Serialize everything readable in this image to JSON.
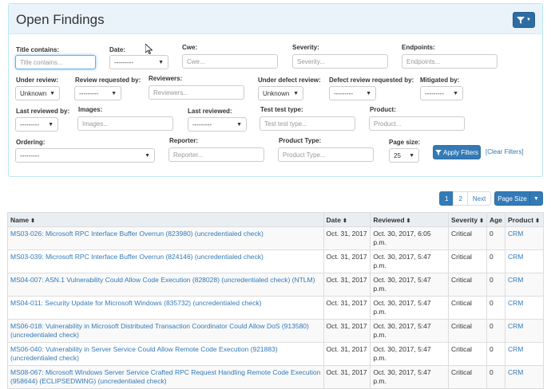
{
  "panel": {
    "title": "Open Findings"
  },
  "filters": {
    "title_contains": {
      "label": "Title contains:",
      "placeholder": "Title contains..."
    },
    "date": {
      "label": "Date:",
      "value": "---------"
    },
    "cwe": {
      "label": "Cwe:",
      "placeholder": "Cwe..."
    },
    "severity": {
      "label": "Severity:",
      "placeholder": "Severity..."
    },
    "endpoints": {
      "label": "Endpoints:",
      "placeholder": "Endpoints..."
    },
    "under_review": {
      "label": "Under review:",
      "value": "Unknown"
    },
    "review_requested_by": {
      "label": "Review requested by:",
      "value": "---------"
    },
    "reviewers": {
      "label": "Reviewers:",
      "placeholder": "Reviewers..."
    },
    "under_defect_review": {
      "label": "Under defect review:",
      "value": "Unknown"
    },
    "defect_review_requested_by": {
      "label": "Defect review requested by:",
      "value": "---------"
    },
    "mitigated_by": {
      "label": "Mitigated by:",
      "value": "---------"
    },
    "last_reviewed_by": {
      "label": "Last reviewed by:",
      "value": "---------"
    },
    "images": {
      "label": "Images:",
      "placeholder": "Images..."
    },
    "last_reviewed": {
      "label": "Last reviewed:",
      "value": "---------"
    },
    "test_test_type": {
      "label": "Test test type:",
      "placeholder": "Test test type..."
    },
    "product": {
      "label": "Product:",
      "placeholder": "Product..."
    },
    "ordering": {
      "label": "Ordering:",
      "value": "---------"
    },
    "reporter": {
      "label": "Reporter:",
      "placeholder": "Reporter..."
    },
    "product_type": {
      "label": "Product Type:",
      "placeholder": "Product Type..."
    },
    "page_size": {
      "label": "Page size:",
      "value": "25"
    },
    "apply_label": "Apply Filters",
    "clear_label": "[Clear Filters]"
  },
  "pagination": {
    "pages": [
      "1",
      "2"
    ],
    "next": "Next",
    "page_size_label": "Page Size"
  },
  "table": {
    "headers": [
      "Name",
      "Date",
      "Reviewed",
      "Severity",
      "Age",
      "Product"
    ],
    "rows": [
      {
        "name": "MS03-026: Microsoft RPC Interface Buffer Overrun (823980) (uncredentialed check)",
        "date": "Oct. 31, 2017",
        "reviewed": "Oct. 30, 2017, 6:05 p.m.",
        "severity": "Critical",
        "age": "0",
        "product": "CRM"
      },
      {
        "name": "MS03-039: Microsoft RPC Interface Buffer Overrun (824146) (uncredentialed check)",
        "date": "Oct. 31, 2017",
        "reviewed": "Oct. 30, 2017, 5:47 p.m.",
        "severity": "Critical",
        "age": "0",
        "product": "CRM"
      },
      {
        "name": "MS04-007: ASN.1 Vulnerability Could Allow Code Execution (828028) (uncredentialed check) (NTLM)",
        "date": "Oct. 31, 2017",
        "reviewed": "Oct. 30, 2017, 5:47 p.m.",
        "severity": "Critical",
        "age": "0",
        "product": "CRM"
      },
      {
        "name": "MS04-011: Security Update for Microsoft Windows (835732) (uncredentialed check)",
        "date": "Oct. 31, 2017",
        "reviewed": "Oct. 30, 2017, 5:47 p.m.",
        "severity": "Critical",
        "age": "0",
        "product": "CRM"
      },
      {
        "name": "MS06-018: Vulnerability in Microsoft Distributed Transaction Coordinator Could Allow DoS (913580) (uncredentialed check)",
        "date": "Oct. 31, 2017",
        "reviewed": "Oct. 30, 2017, 5:47 p.m.",
        "severity": "Critical",
        "age": "0",
        "product": "CRM"
      },
      {
        "name": "MS06-040: Vulnerability in Server Service Could Allow Remote Code Execution (921883) (uncredentialed check)",
        "date": "Oct. 31, 2017",
        "reviewed": "Oct. 30, 2017, 5:47 p.m.",
        "severity": "Critical",
        "age": "0",
        "product": "CRM"
      },
      {
        "name": "MS08-067: Microsoft Windows Server Service Crafted RPC Request Handling Remote Code Execution (958644) (ECLIPSEDWING) (uncredentialed check)",
        "date": "Oct. 31, 2017",
        "reviewed": "Oct. 30, 2017, 5:47 p.m.",
        "severity": "Critical",
        "age": "0",
        "product": "CRM"
      }
    ]
  },
  "colors": {
    "primary": "#337ab7",
    "panel_heading": "#eaf3fa",
    "header_row": "#e9eef3"
  }
}
